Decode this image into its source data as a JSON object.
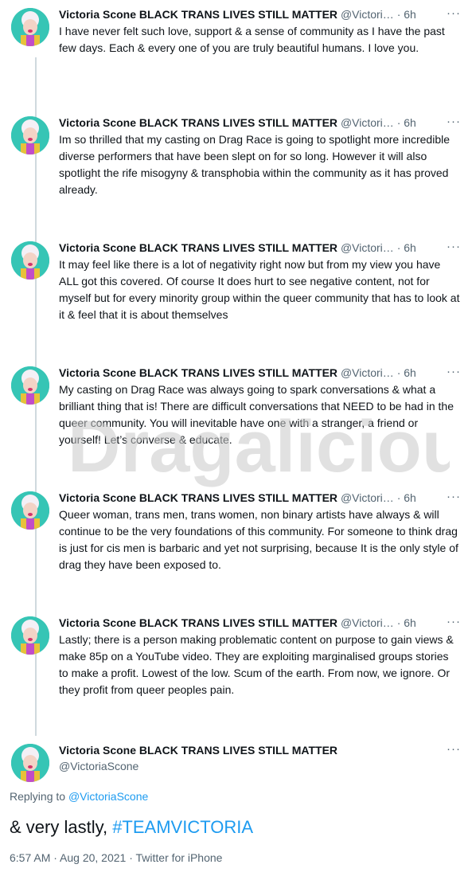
{
  "author": {
    "name": "Victoria Scone BLACK TRANS LIVES STILL MATTER",
    "handle_truncated": "@Victori…",
    "handle": "@VictoriaScone"
  },
  "more_icon": "···",
  "separator": "·",
  "tweets": [
    {
      "time": "6h",
      "text": "I have never felt such love, support & a sense of community as I have the past few days. Each & every one of you are truly beautiful humans. I love you."
    },
    {
      "time": "6h",
      "text": "Im so thrilled that my casting on Drag Race is going to spotlight more incredible diverse performers that have been slept on for so long. However it will also spotlight the rife misogyny & transphobia within the community as it has proved already."
    },
    {
      "time": "6h",
      "text": "It may feel like there is a lot of negativity right now but from my view you have ALL got this covered. Of course It does hurt to see negative content, not for myself but for every minority group within the queer community that has to look at it & feel that it is about themselves"
    },
    {
      "time": "6h",
      "text": "My casting on Drag Race was always going to spark conversations & what a brilliant thing that is! There are difficult conversations that NEED to be had in the queer community. You will inevitable have one with a stranger, a friend or yourself! Let’s converse & educate."
    },
    {
      "time": "6h",
      "text": "Queer woman, trans men, trans women, non binary artists have always & will continue to be the very foundations of this community. For someone to think drag is just for cis men is barbaric and yet not surprising, because It is the only style of drag they have been exposed to."
    },
    {
      "time": "6h",
      "text": "Lastly; there is a person making problematic content on purpose to gain views & make 85p on a YouTube video. They are exploiting marginalised groups stories to make a profit. Lowest of the low. Scum of the earth. From now, we ignore. Or they profit from  queer peoples pain."
    }
  ],
  "main_tweet": {
    "replying_prefix": "Replying to",
    "replying_handle": "@VictoriaScone",
    "text": "& very lastly,",
    "hashtag": "#TEAMVICTORIA",
    "timestamp": "6:57 AM · Aug 20, 2021 · Twitter for iPhone"
  },
  "watermark": "Dragalicious",
  "colors": {
    "text": "#0f1419",
    "secondary": "#536471",
    "link": "#1d9bf0",
    "thread_line": "#cfd9de"
  }
}
